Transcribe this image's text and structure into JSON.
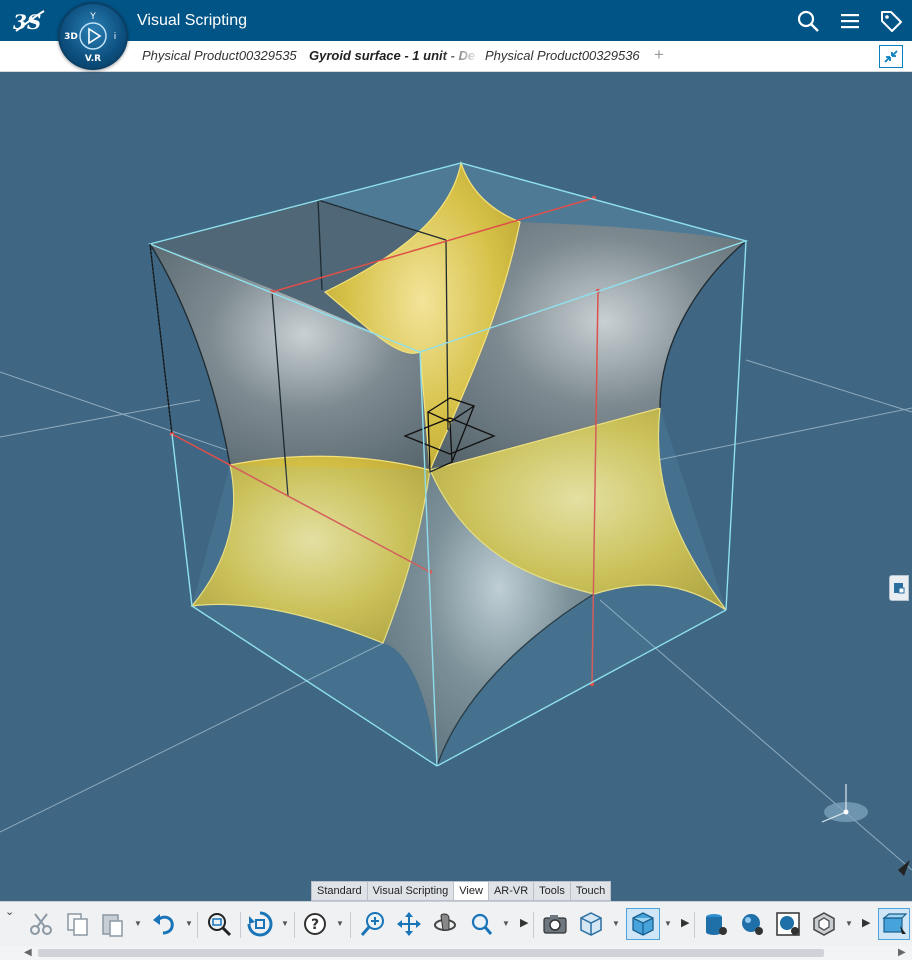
{
  "header": {
    "app_title": "Visual Scripting",
    "compass": {
      "top": "Y",
      "left": "3D",
      "right": "i",
      "bottom": "V.R"
    }
  },
  "tabs": [
    {
      "label": "Physical Product00329535"
    },
    {
      "label": "Gyroid surface - 1 unit - De"
    },
    {
      "label": "Physical Product00329536"
    }
  ],
  "tab_add": "+",
  "section_tabs": [
    "Standard",
    "Visual Scripting",
    "View",
    "AR-VR",
    "Tools",
    "Touch"
  ],
  "active_section": "View",
  "colors": {
    "header_bg": "#005486",
    "viewport_bg": "#3f6683",
    "gyroid_yellow": "#d8c34a",
    "gyroid_gray": "#6c7c85",
    "bbox_line": "#8fe0ee",
    "red_edge": "#e0504a",
    "accent": "#0a7fc1"
  },
  "toolbar_icons": [
    "cut-icon",
    "copy-icon",
    "paste-icon",
    "undo-icon",
    "zoom-fit-icon",
    "fit-all-icon",
    "help-icon",
    "zoom-icon",
    "pan-icon",
    "rotate-icon",
    "zoom-area-icon",
    "capture-icon",
    "view-mode-icon",
    "shading-icon",
    "data-icon",
    "material-icon",
    "render-icon",
    "wireframe-icon",
    "cube-view-icon"
  ]
}
